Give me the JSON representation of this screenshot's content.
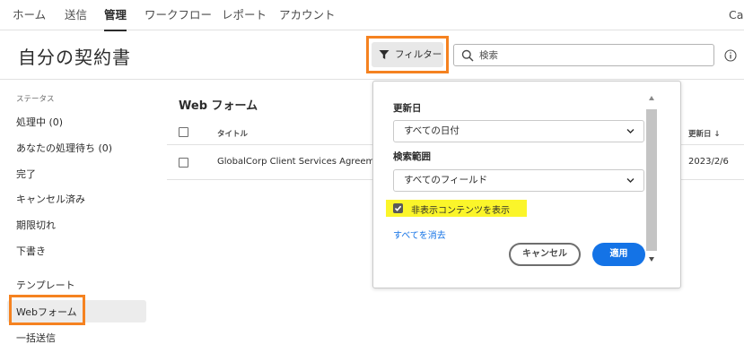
{
  "nav": {
    "items": [
      {
        "label": "ホーム"
      },
      {
        "label": "送信"
      },
      {
        "label": "管理"
      },
      {
        "label": "ワークフロー"
      },
      {
        "label": "レポート"
      },
      {
        "label": "アカウント"
      }
    ],
    "user_fragment": "Cas",
    "active_index": 2
  },
  "header": {
    "title": "自分の契約書",
    "filter_label": "フィルター",
    "search_placeholder": "検索"
  },
  "sidebar": {
    "status_heading": "ステータス",
    "items": [
      {
        "label": "処理中 (0)"
      },
      {
        "label": "あなたの処理待ち (0)"
      },
      {
        "label": "完了"
      },
      {
        "label": "キャンセル済み"
      },
      {
        "label": "期限切れ"
      },
      {
        "label": "下書き"
      }
    ],
    "templates": "テンプレート",
    "webforms": "Webフォーム",
    "bulk_send": "一括送信"
  },
  "main": {
    "title": "Web フォーム",
    "columns": {
      "title": "タイトル",
      "updated": "更新日"
    },
    "rows": [
      {
        "title": "GlobalCorp Client Services Agreement",
        "updated": "2023/2/6"
      }
    ]
  },
  "filter_panel": {
    "updated_label": "更新日",
    "updated_value": "すべての日付",
    "scope_label": "検索範囲",
    "scope_value": "すべてのフィールド",
    "show_hidden_label": "非表示コンテンツを表示",
    "show_hidden_checked": true,
    "clear_all": "すべてを消去",
    "cancel": "キャンセル",
    "apply": "適用"
  },
  "colors": {
    "highlight_orange": "#f58220",
    "highlight_yellow": "#fbf52a",
    "primary_blue": "#1473e6"
  }
}
